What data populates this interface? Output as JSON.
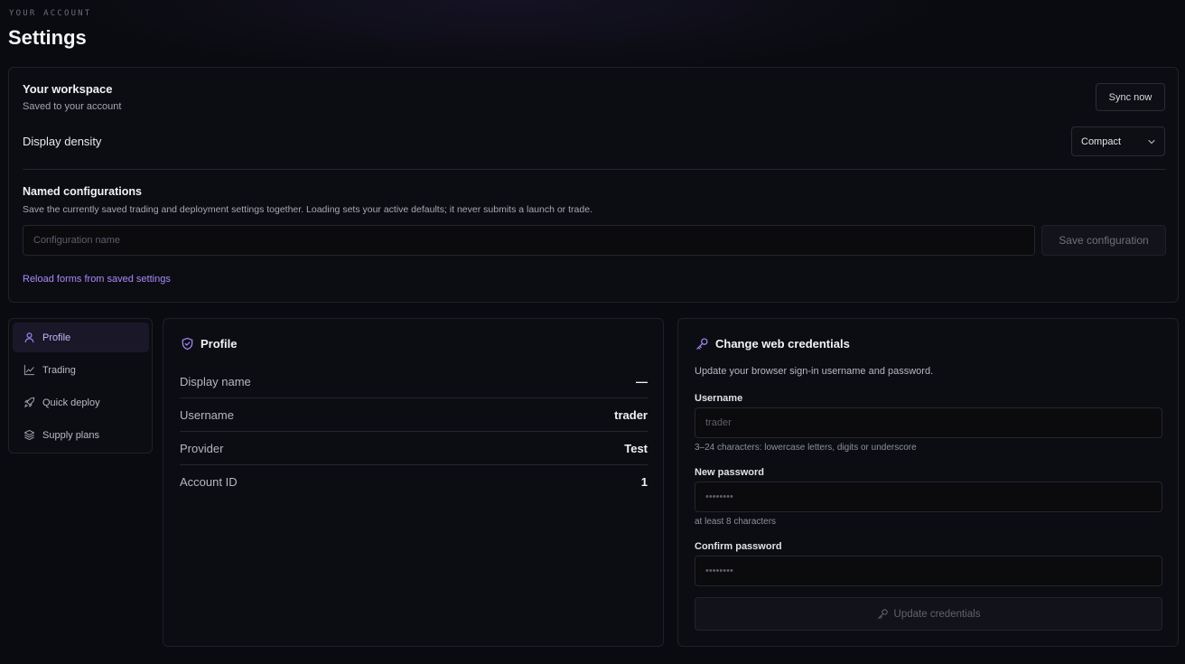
{
  "header": {
    "eyebrow": "YOUR ACCOUNT",
    "title": "Settings"
  },
  "workspace": {
    "title": "Your workspace",
    "subtitle": "Saved to your account",
    "sync_label": "Sync now",
    "density_label": "Display density",
    "density_value": "Compact",
    "named_configs_title": "Named configurations",
    "named_configs_desc": "Save the currently saved trading and deployment settings together. Loading sets your active defaults; it never submits a launch or trade.",
    "config_placeholder": "Configuration name",
    "save_config_label": "Save configuration",
    "reload_link": "Reload forms from saved settings"
  },
  "nav": {
    "items": [
      {
        "label": "Profile",
        "icon": "user-icon",
        "active": true
      },
      {
        "label": "Trading",
        "icon": "line-chart-icon"
      },
      {
        "label": "Quick deploy",
        "icon": "rocket-icon"
      },
      {
        "label": "Supply plans",
        "icon": "layers-icon"
      }
    ]
  },
  "profile": {
    "title": "Profile",
    "rows": [
      {
        "label": "Display name",
        "value": "—"
      },
      {
        "label": "Username",
        "value": "trader"
      },
      {
        "label": "Provider",
        "value": "Test"
      },
      {
        "label": "Account ID",
        "value": "1"
      }
    ]
  },
  "credentials": {
    "title": "Change web credentials",
    "description": "Update your browser sign-in username and password.",
    "username_label": "Username",
    "username_placeholder": "trader",
    "username_hint": "3–24 characters: lowercase letters, digits or underscore",
    "new_password_label": "New password",
    "new_password_placeholder": "••••••••",
    "new_password_hint": "at least 8 characters",
    "confirm_password_label": "Confirm password",
    "confirm_password_placeholder": "••••••••",
    "update_label": "Update credentials"
  },
  "colors": {
    "accent": "#a78bfa",
    "background": "#0a0b10",
    "panel": "#0c0d13",
    "border": "#1f2129"
  }
}
